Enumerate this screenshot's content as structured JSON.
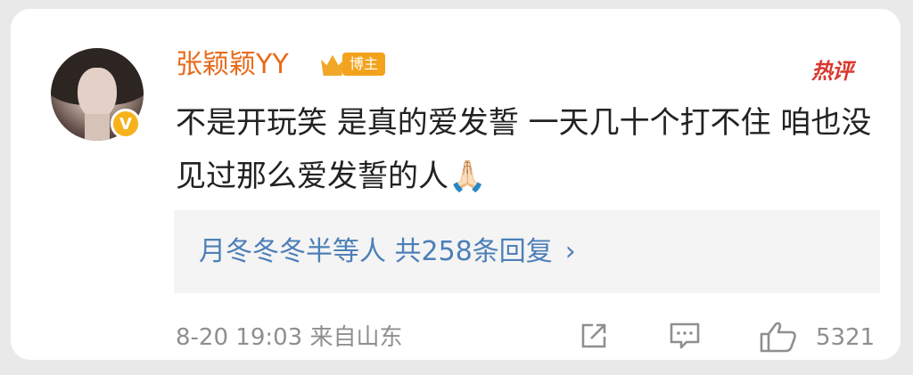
{
  "post": {
    "username": "张颖颖YY",
    "badge_label": "博主",
    "hot_label": "热评",
    "content": "不是开玩笑 是真的爱发誓 一天几十个打不住 咱也没见过那么爱发誓的人🙏🏻",
    "replies_summary": "月冬冬冬半等人 共258条回复",
    "reply_chevron": "›",
    "timestamp": "8-20 19:03 来自山东",
    "like_count": "5321"
  },
  "icons": {
    "share": "share-icon",
    "comment": "comment-icon",
    "like": "like-icon",
    "verified": "verified-v-icon",
    "crown": "crown-icon"
  },
  "colors": {
    "username": "#e86b1a",
    "badge": "#f3a21b",
    "hot": "#d9382f",
    "link": "#4d7fb8",
    "meta": "#8f8f8f"
  },
  "verified_mark": "V"
}
